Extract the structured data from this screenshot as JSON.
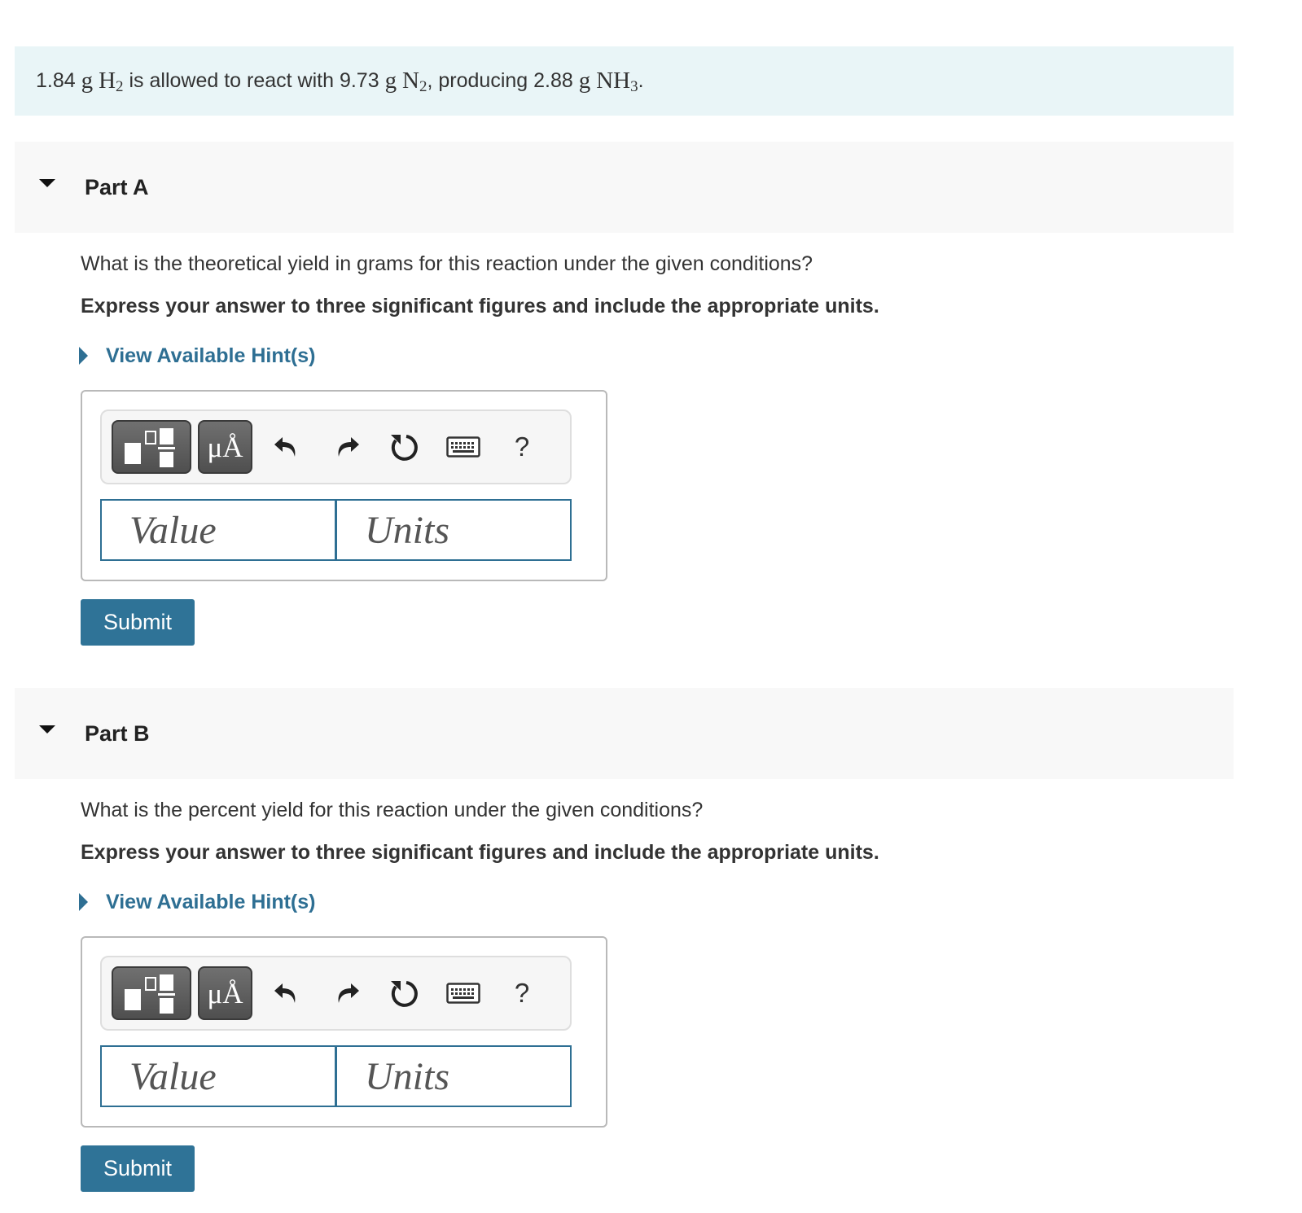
{
  "problem": {
    "mass_h2": "1.84",
    "unit_g": "g",
    "h2_base": "H",
    "h2_sub": "2",
    "text_react": "is allowed to react with",
    "mass_n2": "9.73",
    "n2_base": "N",
    "n2_sub": "2",
    "text_producing": ", producing",
    "mass_nh3": "2.88",
    "nh3_base": "NH",
    "nh3_sub": "3",
    "period": "."
  },
  "parts": [
    {
      "label": "Part A",
      "question": "What is the theoretical yield in grams for this reaction under the given conditions?",
      "instruction": "Express your answer to three significant figures and include the appropriate units.",
      "hint_label": "View Available Hint(s)",
      "value_placeholder": "Value",
      "units_placeholder": "Units",
      "submit_label": "Submit"
    },
    {
      "label": "Part B",
      "question": "What is the percent yield for this reaction under the given conditions?",
      "instruction": "Express your answer to three significant figures and include the appropriate units.",
      "hint_label": "View Available Hint(s)",
      "value_placeholder": "Value",
      "units_placeholder": "Units",
      "submit_label": "Submit"
    }
  ],
  "toolbar": {
    "units_symbol": "μÅ",
    "help": "?",
    "icons": [
      "templates-icon",
      "units-icon",
      "undo-icon",
      "redo-icon",
      "reset-icon",
      "keyboard-icon",
      "help-icon"
    ]
  },
  "colors": {
    "accent": "#2f7397",
    "problem_bg": "#e9f5f7",
    "part_header_bg": "#f8f8f8"
  }
}
